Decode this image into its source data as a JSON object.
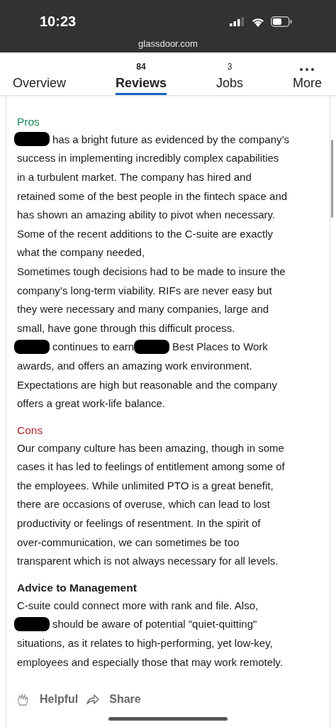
{
  "status_bar": {
    "time": "10:23",
    "url": "glassdoor.com"
  },
  "tabs": [
    {
      "label": "Overview",
      "selected": false
    },
    {
      "label": "Reviews",
      "count": "84",
      "selected": true
    },
    {
      "label": "Jobs",
      "count": "3",
      "selected": false
    },
    {
      "label": "More",
      "kind": "more",
      "selected": false
    }
  ],
  "sections": [
    {
      "kind": "pros",
      "title": "Pros",
      "lines": [
        [
          {
            "kind": "redaction"
          },
          {
            "kind": "text",
            "text": "has a bright future as evidenced by the company’s"
          }
        ],
        [
          {
            "kind": "text",
            "text": "success in implementing incredibly complex capabilities"
          }
        ],
        [
          {
            "kind": "text",
            "text": "in a turbulent market. The company has hired and"
          }
        ],
        [
          {
            "kind": "text",
            "text": "retained some of the best people in the fintech space and"
          }
        ],
        [
          {
            "kind": "text",
            "text": "has shown an amazing ability to pivot when necessary."
          }
        ],
        [
          {
            "kind": "text",
            "text": "Some of the recent additions to the C-suite are exactly"
          }
        ],
        [
          {
            "kind": "text",
            "text": "what the company needed,"
          }
        ],
        [
          {
            "kind": "text",
            "text": "Sometimes tough decisions had to be made to insure the"
          }
        ],
        [
          {
            "kind": "text",
            "text": "company’s long-term viability. RIFs are never easy but"
          }
        ],
        [
          {
            "kind": "text",
            "text": "they were necessary and many companies, large and"
          }
        ],
        [
          {
            "kind": "text",
            "text": "small, have gone through this difficult process."
          }
        ],
        [
          {
            "kind": "redaction"
          },
          {
            "kind": "text",
            "text": "continues to earn"
          },
          {
            "kind": "redaction"
          },
          {
            "kind": "text",
            "text": "Best Places to Work"
          }
        ],
        [
          {
            "kind": "text",
            "text": "awards, and offers an amazing work environment."
          }
        ],
        [
          {
            "kind": "text",
            "text": "Expectations are high but reasonable and the company"
          }
        ],
        [
          {
            "kind": "text",
            "text": "offers a great work-life balance."
          }
        ]
      ]
    },
    {
      "kind": "cons",
      "title": "Cons",
      "lines": [
        [
          {
            "kind": "text",
            "text": "Our company culture has been amazing, though in some"
          }
        ],
        [
          {
            "kind": "text",
            "text": "cases it has led to feelings of entitlement among some of"
          }
        ],
        [
          {
            "kind": "text",
            "text": "the employees. While unlimited PTO is a great benefit,"
          }
        ],
        [
          {
            "kind": "text",
            "text": "there are occasions of overuse, which can lead to lost"
          }
        ],
        [
          {
            "kind": "text",
            "text": "productivity or feelings of resentment. In the spirit of"
          }
        ],
        [
          {
            "kind": "text",
            "text": "over-communication, we can sometimes be too"
          }
        ],
        [
          {
            "kind": "text",
            "text": "transparent which is not always necessary for all levels."
          }
        ]
      ]
    },
    {
      "kind": "advice",
      "title": "Advice to Management",
      "lines": [
        [
          {
            "kind": "text",
            "text": "C-suite could connect more with rank and file. Also,"
          }
        ],
        [
          {
            "kind": "redaction"
          },
          {
            "kind": "text",
            "text": "should be aware of potential \"quiet-quitting\""
          }
        ],
        [
          {
            "kind": "text",
            "text": "situations, as it relates to high-performing, yet low-key,"
          }
        ],
        [
          {
            "kind": "text",
            "text": "employees and especially those that may work remotely."
          }
        ]
      ]
    }
  ],
  "actions": [
    {
      "kind": "helpful",
      "label": "Helpful"
    },
    {
      "kind": "share",
      "label": "Share"
    }
  ]
}
